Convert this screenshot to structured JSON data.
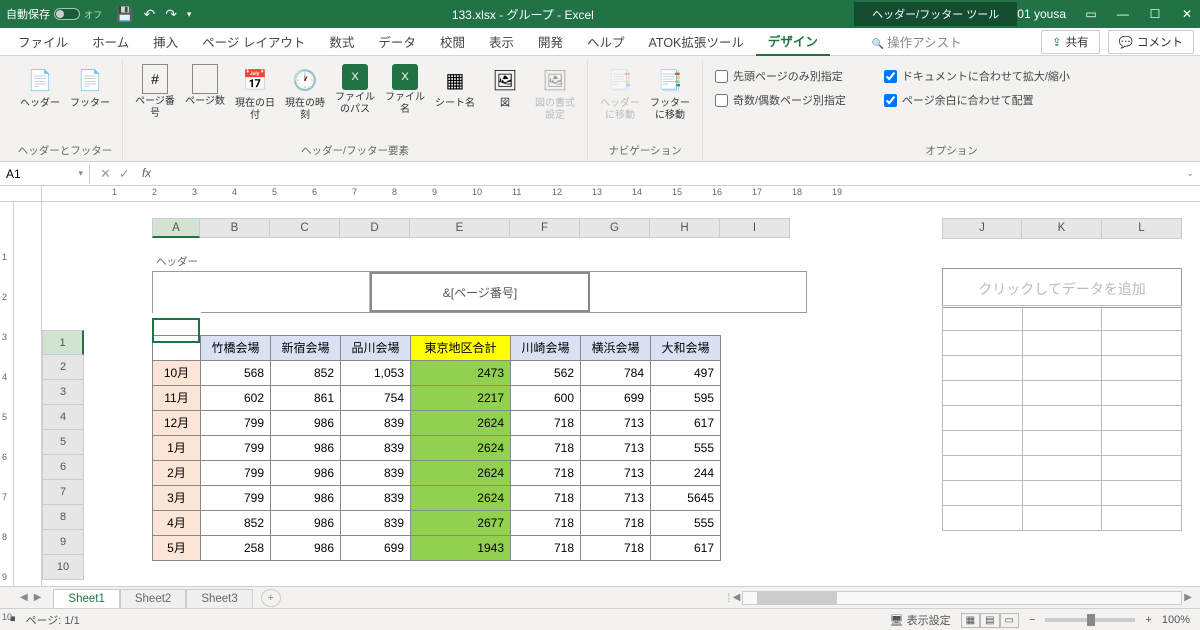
{
  "title": {
    "autosave": "自動保存",
    "autosave_state": "オフ",
    "filename": "133.xlsx  -  グループ  -  Excel",
    "tools": "ヘッダー/フッター ツール",
    "user": "01 yousa"
  },
  "tabs": {
    "file": "ファイル",
    "home": "ホーム",
    "insert": "挿入",
    "layout": "ページ レイアウト",
    "formulas": "数式",
    "data": "データ",
    "review": "校閲",
    "view": "表示",
    "dev": "開発",
    "help": "ヘルプ",
    "atok": "ATOK拡張ツール",
    "design": "デザイン",
    "assist": "操作アシスト",
    "share": "共有",
    "comment": "コメント"
  },
  "ribbon": {
    "g1": "ヘッダーとフッター",
    "g2": "ヘッダー/フッター要素",
    "g3": "ナビゲーション",
    "g4": "オプション",
    "header": "ヘッダー",
    "footer": "フッター",
    "pagenum": "ページ番号",
    "pagecnt": "ページ数",
    "date": "現在の日付",
    "time": "現在の時刻",
    "path": "ファイルのパス",
    "fname": "ファイル名",
    "sname": "シート名",
    "pic": "図",
    "picfmt": "図の書式設定",
    "gohdr": "ヘッダーに移動",
    "goftr": "フッターに移動",
    "opt1": "先頭ページのみ別指定",
    "opt2": "ドキュメントに合わせて拡大/縮小",
    "opt3": "奇数/偶数ページ別指定",
    "opt4": "ページ余白に合わせて配置"
  },
  "namebox": "A1",
  "chart_data": {
    "type": "table",
    "header_label": "ヘッダー",
    "header_center": "&[ページ番号]",
    "cols": [
      "",
      "竹橋会場",
      "新宿会場",
      "品川会場",
      "東京地区合計",
      "川崎会場",
      "横浜会場",
      "大和会場"
    ],
    "colletters": [
      "A",
      "B",
      "C",
      "D",
      "E",
      "F",
      "G",
      "H",
      "I",
      "J",
      "K",
      "L"
    ],
    "rownums": [
      1,
      2,
      3,
      4,
      5,
      6,
      7,
      8,
      9,
      10
    ],
    "rows": [
      {
        "m": "10月",
        "v": [
          568,
          852,
          1053,
          2473,
          562,
          784,
          497
        ]
      },
      {
        "m": "11月",
        "v": [
          602,
          861,
          754,
          2217,
          600,
          699,
          595
        ]
      },
      {
        "m": "12月",
        "v": [
          799,
          986,
          839,
          2624,
          718,
          713,
          617
        ]
      },
      {
        "m": "1月",
        "v": [
          799,
          986,
          839,
          2624,
          718,
          713,
          555
        ]
      },
      {
        "m": "2月",
        "v": [
          799,
          986,
          839,
          2624,
          718,
          713,
          244
        ]
      },
      {
        "m": "3月",
        "v": [
          799,
          986,
          839,
          2624,
          718,
          713,
          5645
        ]
      },
      {
        "m": "4月",
        "v": [
          852,
          986,
          839,
          2677,
          718,
          718,
          555
        ]
      },
      {
        "m": "5月",
        "v": [
          258,
          986,
          699,
          1943,
          718,
          718,
          617
        ]
      }
    ],
    "page2_placeholder": "クリックしてデータを追加"
  },
  "sheets": {
    "s1": "Sheet1",
    "s2": "Sheet2",
    "s3": "Sheet3"
  },
  "status": {
    "page": "ページ: 1/1",
    "disp": "表示設定",
    "zoom": "100%"
  }
}
